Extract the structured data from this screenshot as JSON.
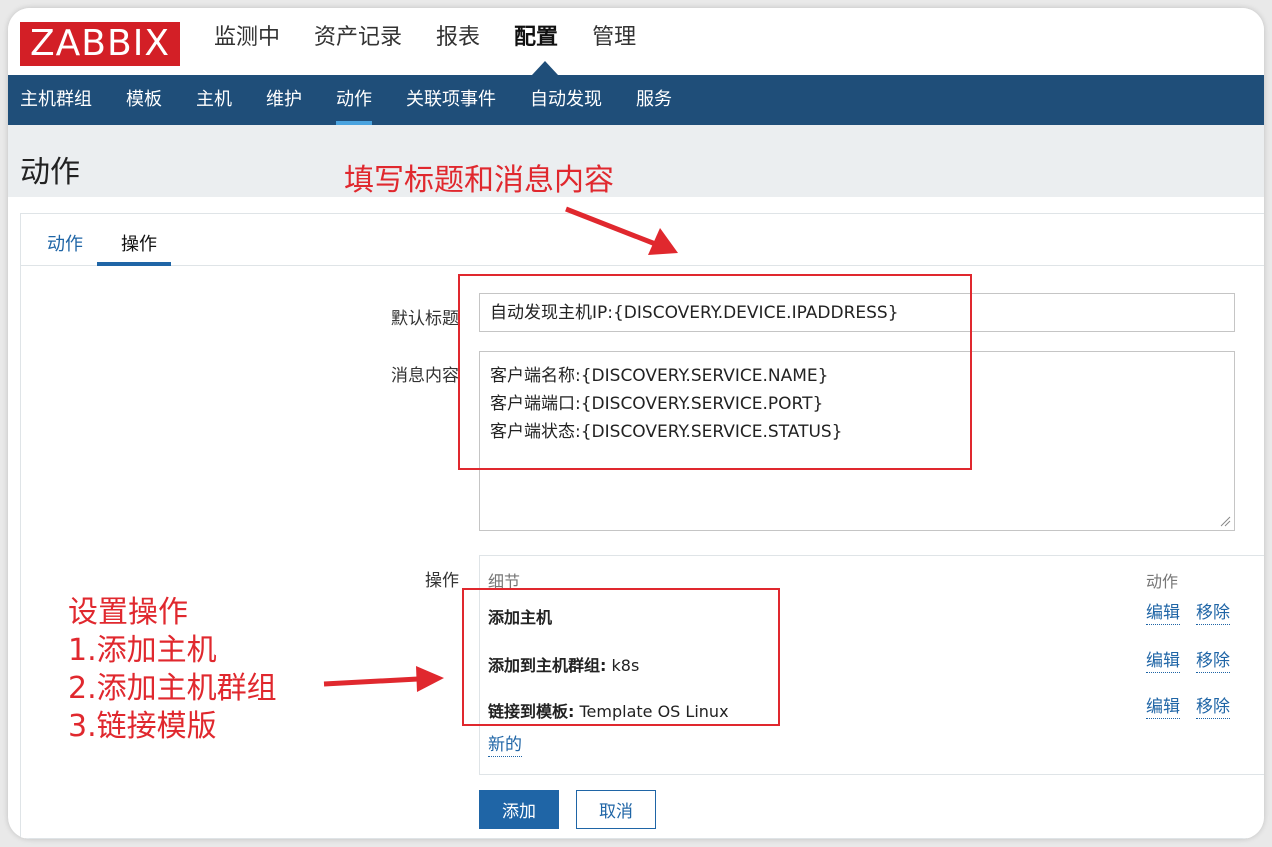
{
  "app": {
    "logo": "ZABBIX",
    "top_menu": [
      "监测中",
      "资产记录",
      "报表",
      "配置",
      "管理"
    ],
    "top_menu_active": "配置",
    "sub_menu": [
      "主机群组",
      "模板",
      "主机",
      "维护",
      "动作",
      "关联项事件",
      "自动发现",
      "服务"
    ],
    "sub_menu_active": "动作"
  },
  "page": {
    "title": "动作",
    "tabs": [
      "动作",
      "操作"
    ]
  },
  "form": {
    "default_subject_label": "默认标题",
    "default_subject_value": "自动发现主机IP:{DISCOVERY.DEVICE.IPADDRESS}",
    "message_label": "消息内容",
    "message_lines": [
      "客户端名称:{DISCOVERY.SERVICE.NAME}",
      "客户端端口:{DISCOVERY.SERVICE.PORT}",
      "客户端状态:{DISCOVERY.SERVICE.STATUS}"
    ],
    "operations_label": "操作",
    "operations_header_details": "细节",
    "operations_header_action": "动作",
    "operations": [
      {
        "title": "添加主机",
        "value": ""
      },
      {
        "title": "添加到主机群组:",
        "value": " k8s"
      },
      {
        "title": "链接到模板:",
        "value": " Template OS Linux"
      }
    ],
    "edit_label": "编辑",
    "remove_label": "移除",
    "new_label": "新的",
    "add_button": "添加",
    "cancel_button": "取消"
  },
  "annotations": {
    "top_note": "填写标题和消息内容",
    "left_note": [
      "设置操作",
      "1.添加主机",
      "2.添加主机群组",
      "3.链接模版"
    ],
    "color": "#e0282e"
  },
  "colors": {
    "brand_red": "#d31f26",
    "nav_blue": "#1f4e79",
    "link_blue": "#1f65a6"
  }
}
